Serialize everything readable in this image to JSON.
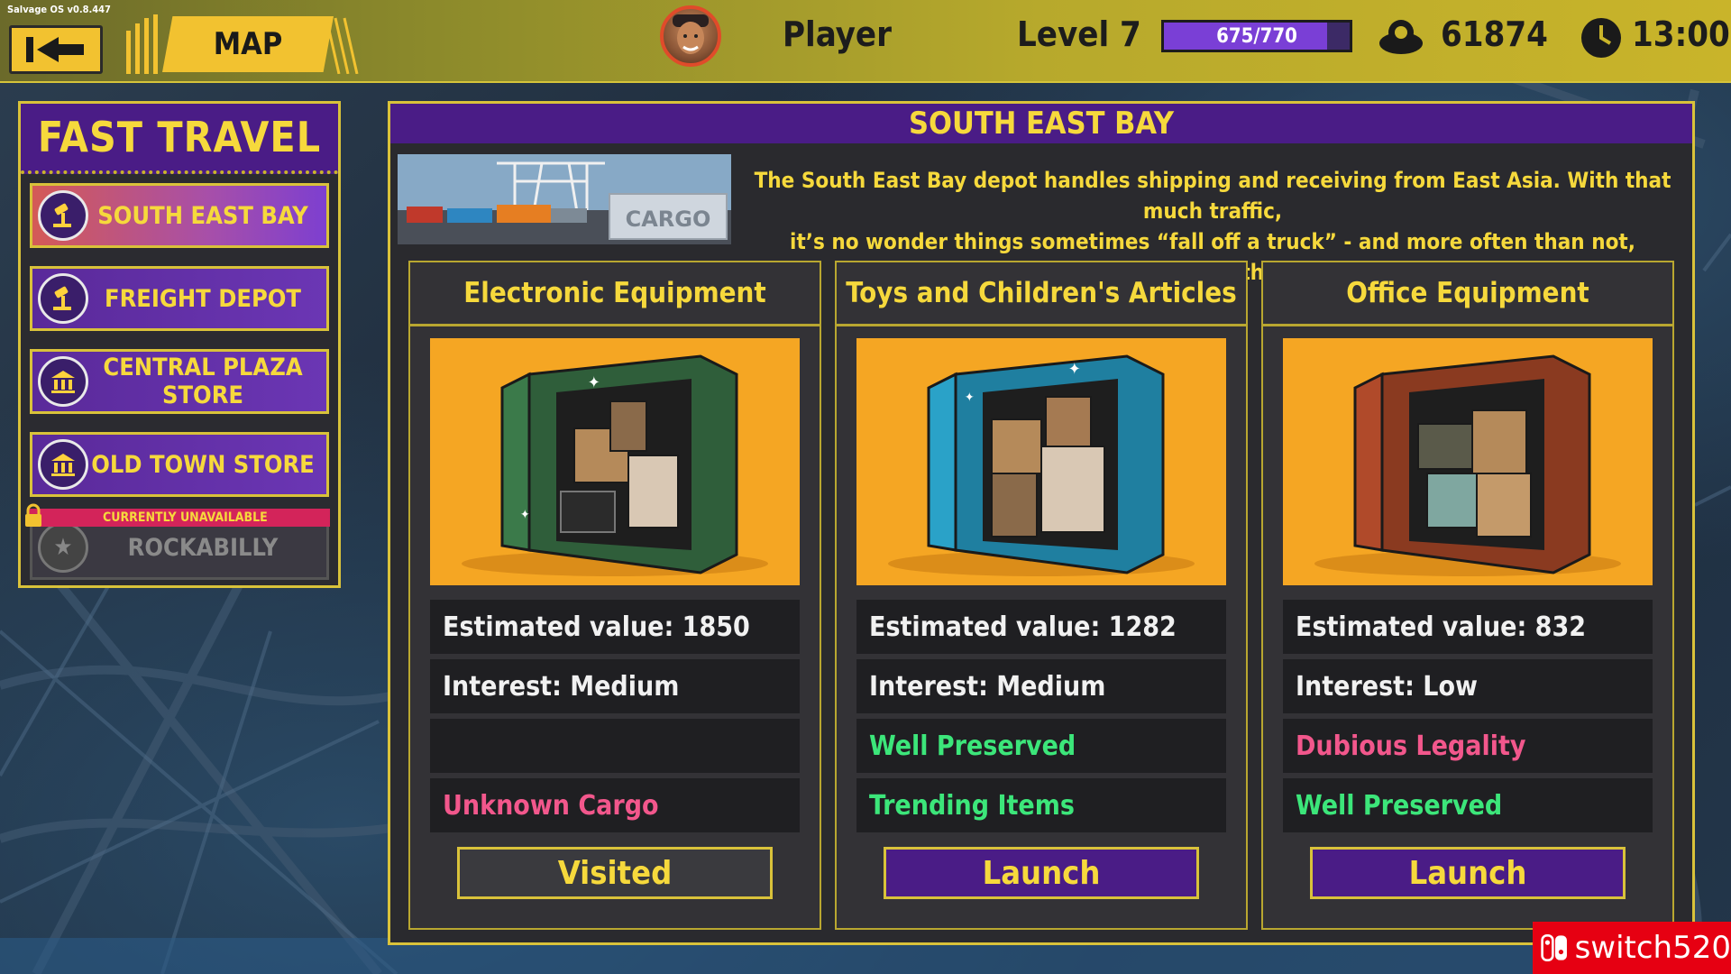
{
  "app": {
    "version": "Salvage OS v0.8.447"
  },
  "header": {
    "tab_label": "MAP",
    "player_name": "Player",
    "level": "Level 7",
    "xp_text": "675/770",
    "xp_fraction": 0.877,
    "coins": "61874",
    "time": "13:00"
  },
  "fast_travel": {
    "title": "FAST TRAVEL",
    "items": [
      {
        "label": "SOUTH EAST BAY",
        "icon": "gavel-icon",
        "active": true
      },
      {
        "label": "FREIGHT DEPOT",
        "icon": "gavel-icon"
      },
      {
        "label": "CENTRAL PLAZA STORE",
        "icon": "store-icon"
      },
      {
        "label": "OLD TOWN STORE",
        "icon": "store-icon"
      },
      {
        "label": "ROCKABILLY",
        "icon": "star-icon",
        "locked": true
      }
    ],
    "unavailable_label": "CURRENTLY UNAVAILABLE"
  },
  "location": {
    "title": "SOUTH EAST BAY",
    "image_sign": "CARGO",
    "description_line1": "The South East Bay depot handles shipping and receiving from East Asia. With that much traffic,",
    "description_line2": "it’s no wonder things sometimes “fall off a truck” - and more often than not, straight into the bay."
  },
  "containers": [
    {
      "title": "Electronic Equipment",
      "color": "#3b7a4a",
      "value": "Estimated value: 1850",
      "interest": "Interest: Medium",
      "trait1": "",
      "trait2": "Unknown Cargo",
      "button": "Visited"
    },
    {
      "title": "Toys and Children's Articles",
      "color": "#2aa2c8",
      "value": "Estimated value: 1282",
      "interest": "Interest: Medium",
      "trait1": "Well Preserved",
      "trait2": "Trending Items",
      "button": "Launch"
    },
    {
      "title": "Office Equipment",
      "color": "#b04a2a",
      "value": "Estimated value: 832",
      "interest": "Interest: Low",
      "trait1": "Dubious Legality",
      "trait2": "Well Preserved",
      "button": "Launch"
    }
  ],
  "watermark": {
    "text": "switch520"
  }
}
